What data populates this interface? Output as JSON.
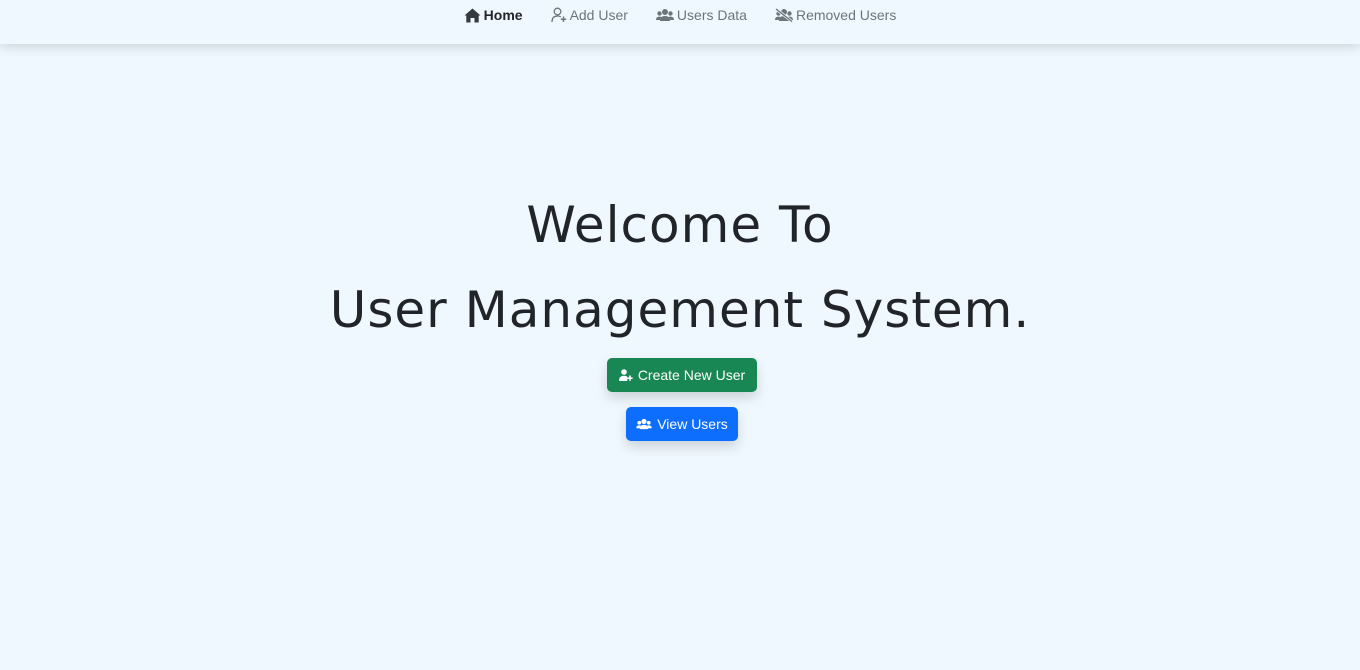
{
  "nav": {
    "items": [
      {
        "label": "Home",
        "icon": "home-icon",
        "active": true
      },
      {
        "label": "Add User",
        "icon": "user-plus-icon",
        "active": false
      },
      {
        "label": "Users Data",
        "icon": "users-icon",
        "active": false
      },
      {
        "label": "Removed Users",
        "icon": "users-slash-icon",
        "active": false
      }
    ]
  },
  "hero": {
    "title_line1": "Welcome To",
    "title_line2": "User Management System.",
    "create_button": "Create New User",
    "view_button": "View Users"
  },
  "colors": {
    "background": "#f0f8ff",
    "create_button": "#198754",
    "view_button": "#0d6efd",
    "text": "#212529",
    "nav_muted": "#6c757d"
  }
}
